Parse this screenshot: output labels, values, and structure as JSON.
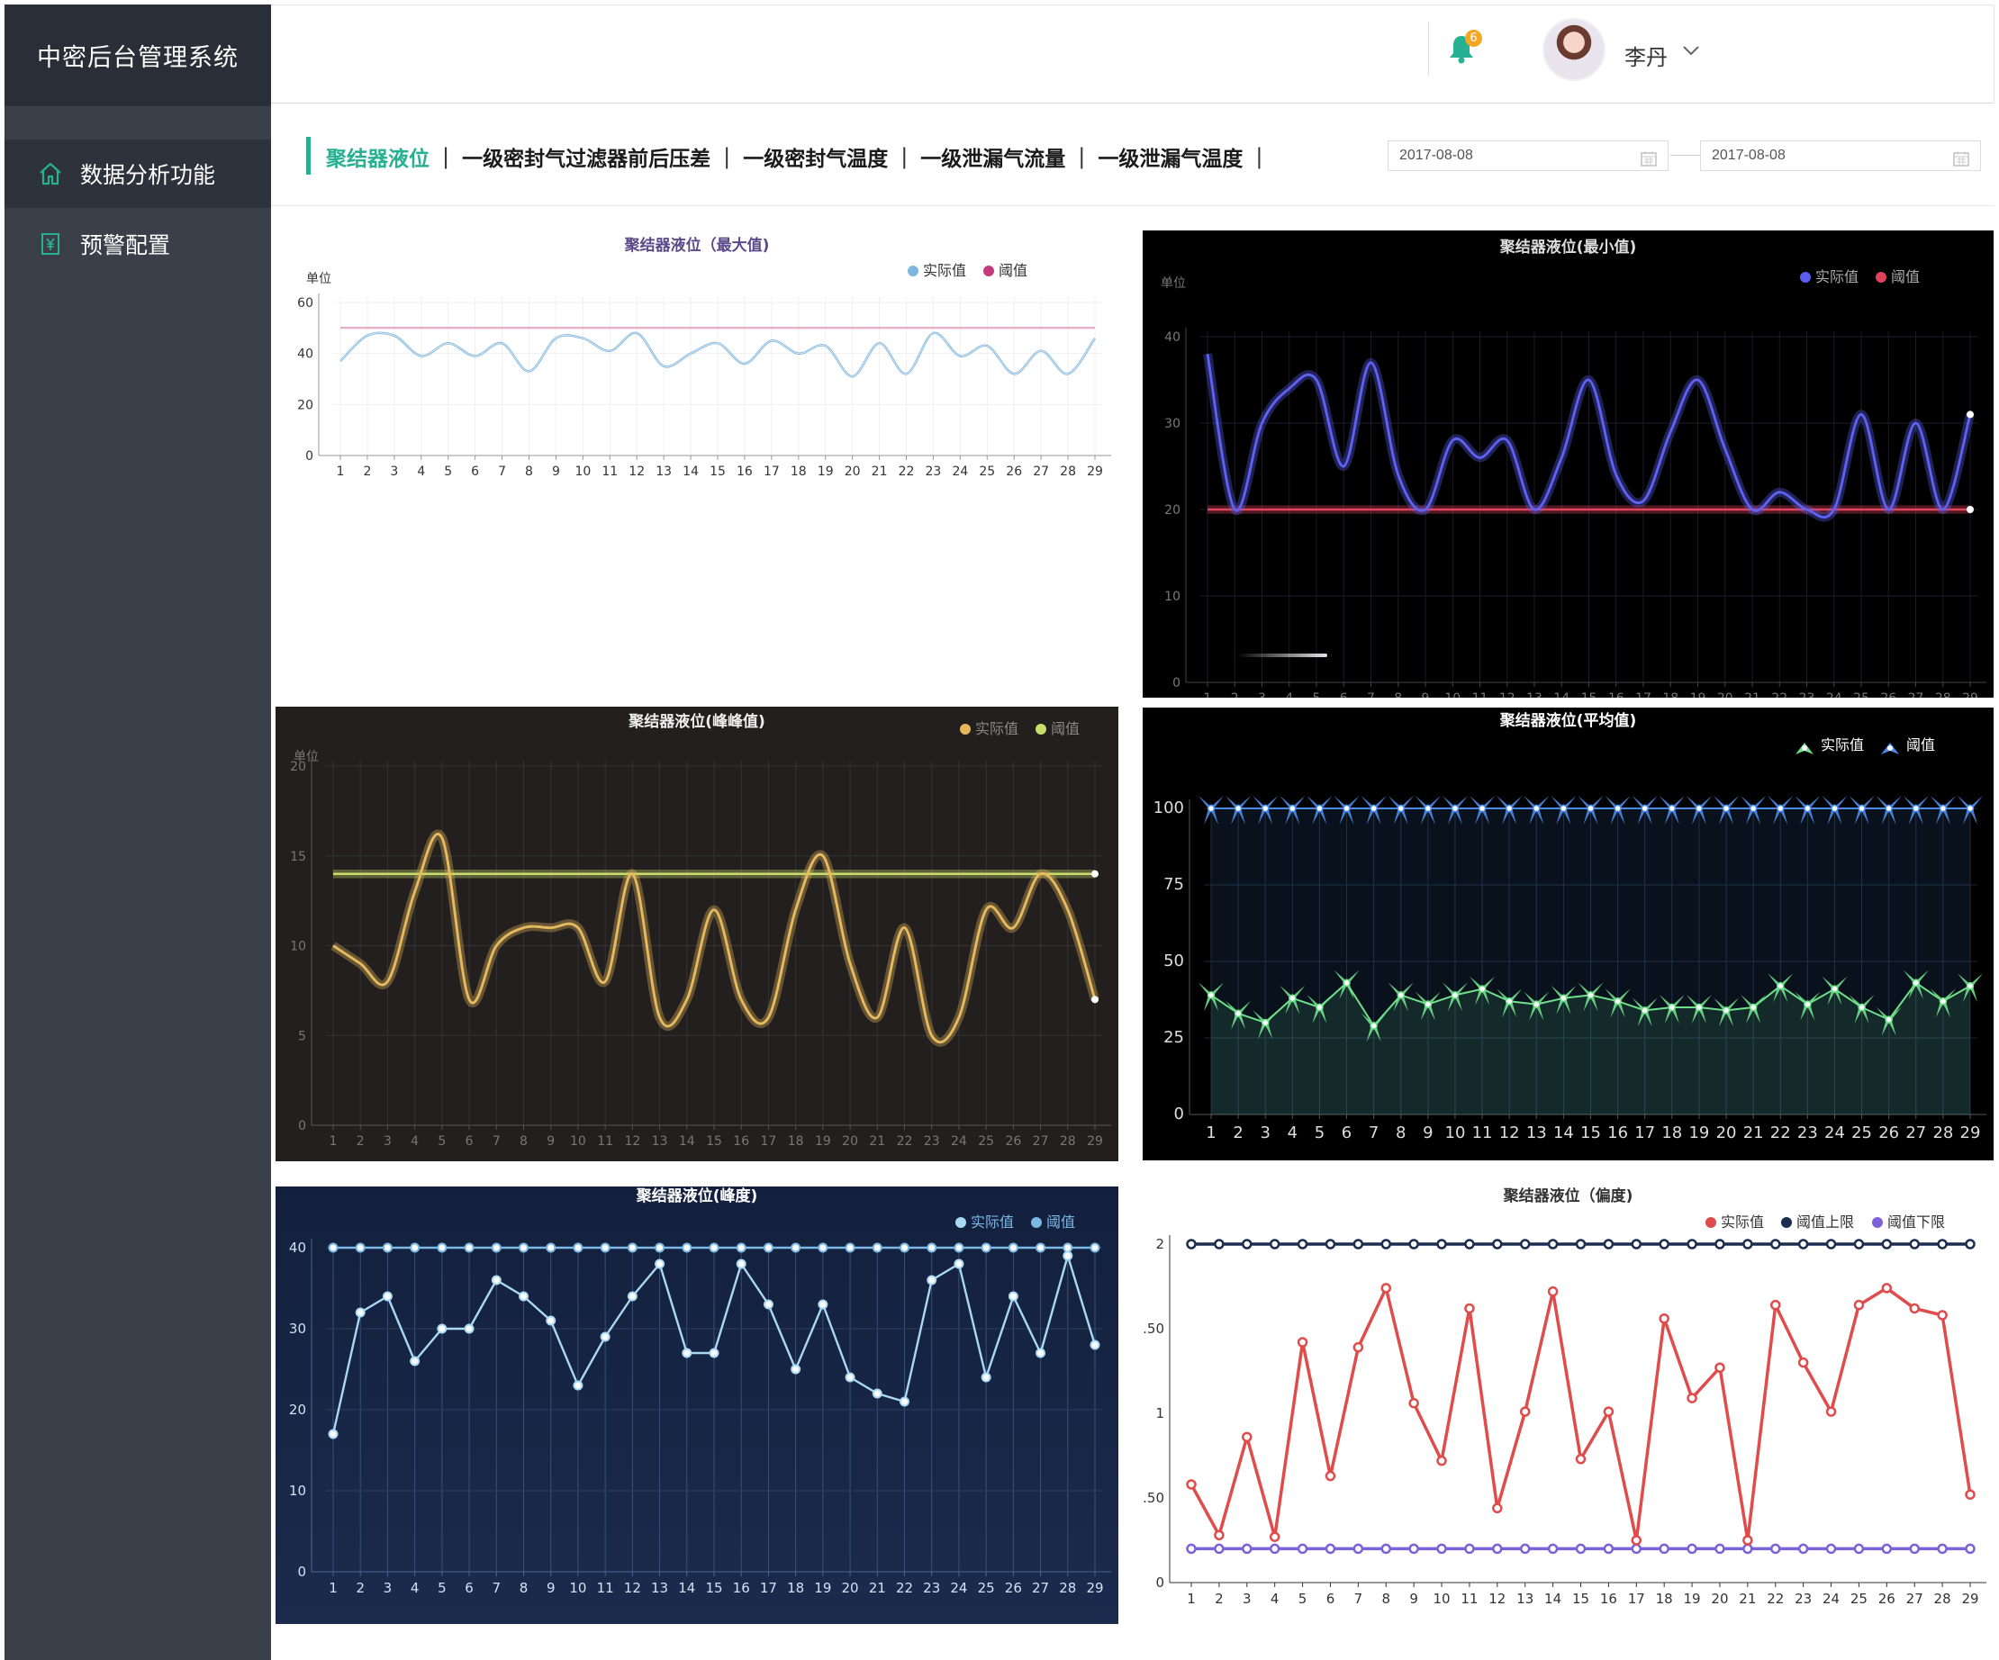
{
  "app": {
    "title": "中密后台管理系统"
  },
  "sidebar": {
    "items": [
      {
        "label": "数据分析功能",
        "icon": "home-icon",
        "active": true
      },
      {
        "label": "预警配置",
        "icon": "yen-settings-icon",
        "active": false
      }
    ]
  },
  "header": {
    "notifications": {
      "count": "6",
      "icon": "bell-icon"
    },
    "user": {
      "name": "李丹",
      "icon": "chevron-down-icon"
    }
  },
  "tabs": [
    {
      "label": "聚结器液位",
      "active": true
    },
    {
      "label": "一级密封气过滤器前后压差",
      "active": false
    },
    {
      "label": "一级密封气温度",
      "active": false
    },
    {
      "label": "一级泄漏气流量",
      "active": false
    },
    {
      "label": "一级泄漏气温度",
      "active": false
    }
  ],
  "date_range": {
    "start": "2017-08-08",
    "end": "2017-08-08"
  },
  "colors": {
    "accent": "#27b091",
    "sidebar": "#3a3f4a",
    "brand_bg": "#2a2e36"
  },
  "chart_data": [
    {
      "id": "c1",
      "type": "line",
      "title": "聚结器液位（最大值)",
      "ylabel": "单位",
      "ylim": [
        0,
        60
      ],
      "yticks": [
        0,
        20,
        40,
        60
      ],
      "x": [
        1,
        2,
        3,
        4,
        5,
        6,
        7,
        8,
        9,
        10,
        11,
        12,
        13,
        14,
        15,
        16,
        17,
        18,
        19,
        20,
        21,
        22,
        23,
        24,
        25,
        26,
        27,
        28,
        29
      ],
      "series": [
        {
          "name": "实际值",
          "color": "#7fb6dd",
          "values": [
            37,
            47,
            47,
            39,
            44,
            39,
            44,
            33,
            46,
            46,
            41,
            48,
            35,
            40,
            44,
            36,
            45,
            40,
            43,
            31,
            44,
            32,
            48,
            39,
            43,
            32,
            41,
            32,
            46
          ]
        },
        {
          "name": "阈值",
          "color": "#c23a7a",
          "values": [
            50,
            50,
            50,
            50,
            50,
            50,
            50,
            50,
            50,
            50,
            50,
            50,
            50,
            50,
            50,
            50,
            50,
            50,
            50,
            50,
            50,
            50,
            50,
            50,
            50,
            50,
            50,
            50,
            50
          ]
        }
      ]
    },
    {
      "id": "c2",
      "type": "line",
      "title": "聚结器液位(最小值)",
      "ylabel": "单位",
      "ylim": [
        0,
        40
      ],
      "yticks": [
        0,
        10,
        20,
        30,
        40
      ],
      "x": [
        1,
        2,
        3,
        4,
        5,
        6,
        7,
        8,
        9,
        10,
        11,
        12,
        13,
        14,
        15,
        16,
        17,
        18,
        19,
        20,
        21,
        22,
        23,
        24,
        25,
        26,
        27,
        28,
        29
      ],
      "series": [
        {
          "name": "实际值",
          "color": "#5b5ef0",
          "values": [
            38,
            20,
            30,
            34,
            35,
            25,
            37,
            24,
            20,
            28,
            26,
            28,
            20,
            26,
            35,
            24,
            21,
            29,
            35,
            27,
            20,
            22,
            20,
            20,
            31,
            20,
            30,
            20,
            31
          ]
        },
        {
          "name": "阈值",
          "color": "#e0415b",
          "values": [
            20,
            20,
            20,
            20,
            20,
            20,
            20,
            20,
            20,
            20,
            20,
            20,
            20,
            20,
            20,
            20,
            20,
            20,
            20,
            20,
            20,
            20,
            20,
            20,
            20,
            20,
            20,
            20,
            20
          ]
        }
      ]
    },
    {
      "id": "c3",
      "type": "line",
      "title": "聚结器液位(峰峰值)",
      "ylabel": "单位",
      "ylim": [
        0,
        20
      ],
      "yticks": [
        0,
        5,
        10,
        15,
        20
      ],
      "x": [
        1,
        2,
        3,
        4,
        5,
        6,
        7,
        8,
        9,
        10,
        11,
        12,
        13,
        14,
        15,
        16,
        17,
        18,
        19,
        20,
        21,
        22,
        23,
        24,
        25,
        26,
        27,
        28,
        29
      ],
      "series": [
        {
          "name": "实际值",
          "color": "#e6b85c",
          "values": [
            10,
            9,
            8,
            13,
            16,
            7,
            10,
            11,
            11,
            11,
            8,
            14,
            6,
            7,
            12,
            7,
            6,
            12,
            15,
            9,
            6,
            11,
            5,
            6,
            12,
            11,
            14,
            12,
            7
          ]
        },
        {
          "name": "阈值",
          "color": "#c8de6a",
          "values": [
            14,
            14,
            14,
            14,
            14,
            14,
            14,
            14,
            14,
            14,
            14,
            14,
            14,
            14,
            14,
            14,
            14,
            14,
            14,
            14,
            14,
            14,
            14,
            14,
            14,
            14,
            14,
            14,
            14
          ]
        }
      ]
    },
    {
      "id": "c4",
      "type": "line",
      "title": "聚结器液位(平均值)",
      "ylim": [
        0,
        100
      ],
      "yticks": [
        0,
        25,
        50,
        75,
        100
      ],
      "x": [
        1,
        2,
        3,
        4,
        5,
        6,
        7,
        8,
        9,
        10,
        11,
        12,
        13,
        14,
        15,
        16,
        17,
        18,
        19,
        20,
        21,
        22,
        23,
        24,
        25,
        26,
        27,
        28,
        29
      ],
      "series": [
        {
          "name": "实际值",
          "color": "#6fe08a",
          "values": [
            39,
            33,
            30,
            38,
            35,
            43,
            29,
            39,
            36,
            39,
            41,
            37,
            36,
            38,
            39,
            37,
            34,
            35,
            35,
            34,
            35,
            42,
            36,
            41,
            35,
            31,
            43,
            37,
            42
          ]
        },
        {
          "name": "阈值",
          "color": "#4a8be8",
          "values": [
            100,
            100,
            100,
            100,
            100,
            100,
            100,
            100,
            100,
            100,
            100,
            100,
            100,
            100,
            100,
            100,
            100,
            100,
            100,
            100,
            100,
            100,
            100,
            100,
            100,
            100,
            100,
            100,
            100
          ]
        }
      ]
    },
    {
      "id": "c5",
      "type": "line",
      "title": "聚结器液位(峰度)",
      "ylim": [
        0,
        40
      ],
      "yticks": [
        0,
        10,
        20,
        30,
        40
      ],
      "x": [
        1,
        2,
        3,
        4,
        5,
        6,
        7,
        8,
        9,
        10,
        11,
        12,
        13,
        14,
        15,
        16,
        17,
        18,
        19,
        20,
        21,
        22,
        23,
        24,
        25,
        26,
        27,
        28,
        29
      ],
      "series": [
        {
          "name": "实际值",
          "color": "#a9d8f2",
          "values": [
            17,
            32,
            34,
            26,
            30,
            30,
            36,
            34,
            31,
            23,
            29,
            34,
            38,
            27,
            27,
            38,
            33,
            25,
            33,
            24,
            22,
            21,
            36,
            38,
            24,
            34,
            27,
            39,
            28
          ]
        },
        {
          "name": "阈值",
          "color": "#7ab8e6",
          "values": [
            40,
            40,
            40,
            40,
            40,
            40,
            40,
            40,
            40,
            40,
            40,
            40,
            40,
            40,
            40,
            40,
            40,
            40,
            40,
            40,
            40,
            40,
            40,
            40,
            40,
            40,
            40,
            40,
            40
          ]
        }
      ]
    },
    {
      "id": "c6",
      "type": "line",
      "title": "聚结器液位（偏度)",
      "ylim": [
        0,
        2
      ],
      "yticks": [
        "0",
        ".50",
        "1",
        ".50",
        "2"
      ],
      "x": [
        1,
        2,
        3,
        4,
        5,
        6,
        7,
        8,
        9,
        10,
        11,
        12,
        13,
        14,
        15,
        16,
        17,
        18,
        19,
        20,
        21,
        22,
        23,
        24,
        25,
        26,
        27,
        28,
        29
      ],
      "series": [
        {
          "name": "实际值",
          "color": "#e04b4b",
          "values": [
            0.58,
            0.28,
            0.86,
            0.27,
            1.42,
            0.63,
            1.39,
            1.74,
            1.06,
            0.72,
            1.62,
            0.44,
            1.01,
            1.72,
            0.73,
            1.01,
            0.25,
            1.56,
            1.09,
            1.27,
            0.25,
            1.64,
            1.3,
            1.01,
            1.64,
            1.74,
            1.62,
            1.58,
            0.52
          ]
        },
        {
          "name": "阈值上限",
          "color": "#1d2d4f",
          "values": [
            2,
            2,
            2,
            2,
            2,
            2,
            2,
            2,
            2,
            2,
            2,
            2,
            2,
            2,
            2,
            2,
            2,
            2,
            2,
            2,
            2,
            2,
            2,
            2,
            2,
            2,
            2,
            2,
            2
          ]
        },
        {
          "name": "阈值下限",
          "color": "#7b62d6",
          "values": [
            0.2,
            0.2,
            0.2,
            0.2,
            0.2,
            0.2,
            0.2,
            0.2,
            0.2,
            0.2,
            0.2,
            0.2,
            0.2,
            0.2,
            0.2,
            0.2,
            0.2,
            0.2,
            0.2,
            0.2,
            0.2,
            0.2,
            0.2,
            0.2,
            0.2,
            0.2,
            0.2,
            0.2,
            0.2
          ]
        }
      ]
    }
  ]
}
